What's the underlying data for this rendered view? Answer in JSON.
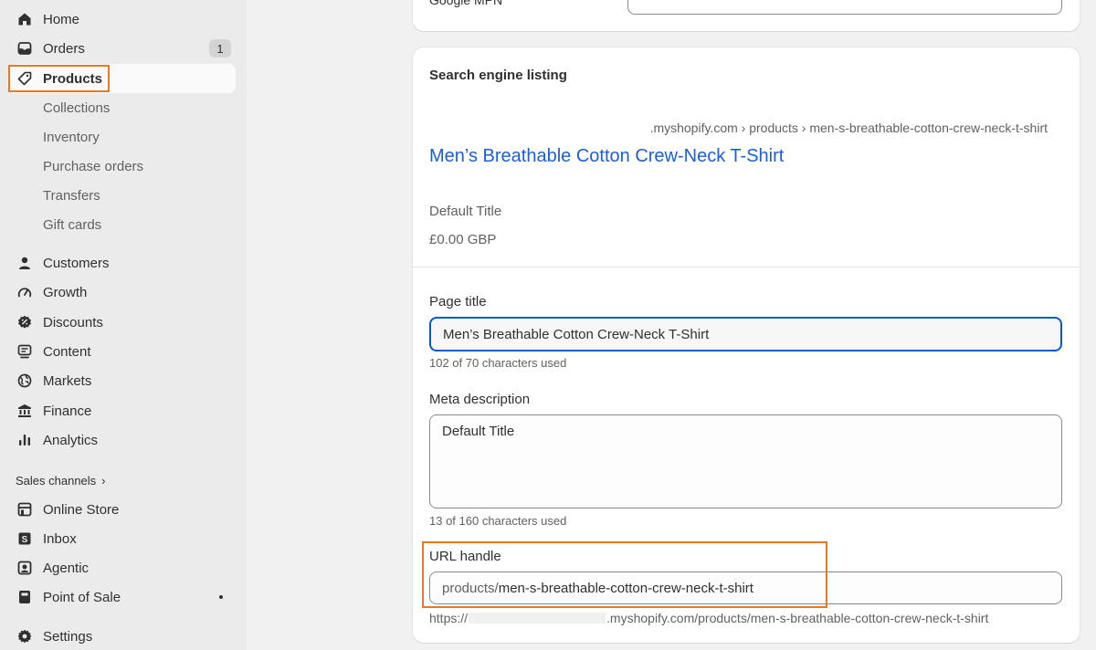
{
  "sidebar": {
    "items": [
      {
        "label": "Home",
        "icon": "home-icon"
      },
      {
        "label": "Orders",
        "icon": "orders-icon",
        "badge": "1"
      },
      {
        "label": "Products",
        "icon": "tag-icon"
      },
      {
        "label": "Customers",
        "icon": "person-icon"
      },
      {
        "label": "Growth",
        "icon": "gauge-icon"
      },
      {
        "label": "Discounts",
        "icon": "discount-icon"
      },
      {
        "label": "Content",
        "icon": "content-icon"
      },
      {
        "label": "Markets",
        "icon": "globe-icon"
      },
      {
        "label": "Finance",
        "icon": "bank-icon"
      },
      {
        "label": "Analytics",
        "icon": "bar-chart-icon"
      }
    ],
    "product_sub": [
      "Collections",
      "Inventory",
      "Purchase orders",
      "Transfers",
      "Gift cards"
    ],
    "sales_channels_label": "Sales channels",
    "sales_channels_chevron": "›",
    "channels": [
      {
        "label": "Online Store",
        "icon": "store-icon"
      },
      {
        "label": "Inbox",
        "icon": "inbox-icon"
      },
      {
        "label": "Agentic",
        "icon": "agentic-icon"
      },
      {
        "label": "Point of Sale",
        "icon": "pos-icon"
      }
    ],
    "settings_label": "Settings",
    "accent": "#e8791f"
  },
  "top_card": {
    "cut_label": "Google MPN"
  },
  "seo": {
    "title": "Search engine listing",
    "breadcrumb": ".myshopify.com › products › men-s-breathable-cotton-crew-neck-t-shirt",
    "link": "Men’s Breathable Cotton Crew-Neck T-Shirt",
    "desc": "Default Title",
    "price": "£0.00 GBP",
    "page_title_label": "Page title",
    "page_title_value": "Men’s Breathable Cotton Crew-Neck T-Shirt",
    "page_title_help": "102 of 70 characters used",
    "meta_label": "Meta description",
    "meta_value": "Default Title",
    "meta_help": "13 of 160 characters used",
    "url_label": "URL handle",
    "url_prefix": "products/",
    "url_value": "men-s-breathable-cotton-crew-neck-t-shirt",
    "url_preview_start": "https://",
    "url_preview_end": ".myshopify.com/products/men-s-breathable-cotton-crew-neck-t-shirt",
    "link_color": "#1a5fd6",
    "focus_color": "#005bd3"
  }
}
